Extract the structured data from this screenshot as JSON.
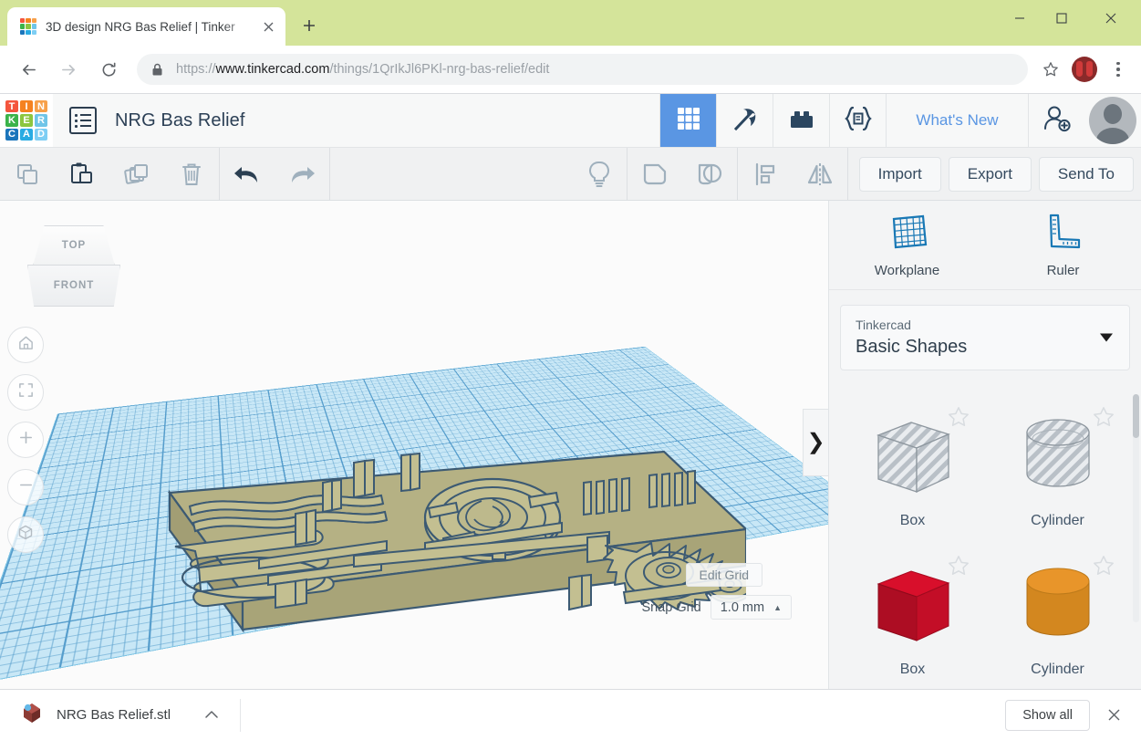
{
  "browser": {
    "tab": {
      "title": "3D design NRG Bas Relief | Tinker",
      "close_icon": "close-icon",
      "favicon_colors": [
        "#f4553d",
        "#f58220",
        "#f7a04a",
        "#3bb34a",
        "#8cc63f",
        "#6fc5e8",
        "#1b75bb",
        "#29abe2",
        "#7ecef4"
      ]
    },
    "new_tab_label": "+",
    "nav": {
      "back": "←",
      "forward": "→",
      "reload": "⟳"
    },
    "url": {
      "scheme": "https://",
      "host": "www.tinkercad.com",
      "path": "/things/1QrIkJl6PKl-nrg-bas-relief/edit"
    },
    "url_full": "https://www.tinkercad.com/things/1QrIkJl6PKl-nrg-bas-relief/edit",
    "window_controls": {
      "minimize": "minimize-icon",
      "maximize": "maximize-icon",
      "close": "close-icon"
    },
    "titlebar_color": "#d4e49a"
  },
  "tinkercad_header": {
    "logo_letters": [
      "T",
      "I",
      "N",
      "K",
      "E",
      "R",
      "C",
      "A",
      "D"
    ],
    "design_title": "NRG Bas Relief",
    "tools": [
      {
        "name": "3d-design",
        "icon": "grid-icon",
        "active": true
      },
      {
        "name": "minecraft",
        "icon": "pickaxe-icon",
        "active": false
      },
      {
        "name": "bricks",
        "icon": "lego-brick-icon",
        "active": false
      },
      {
        "name": "codeblocks",
        "icon": "codeblocks-icon",
        "active": false
      }
    ],
    "whats_new_label": "What's New",
    "invite_icon": "add-person-icon",
    "avatar_icon": "user-avatar",
    "accent_color": "#5a96e3"
  },
  "edit_toolbar": {
    "left_buttons": [
      {
        "name": "copy",
        "icon": "copy-icon",
        "enabled": false
      },
      {
        "name": "paste",
        "icon": "paste-icon",
        "enabled": true
      },
      {
        "name": "duplicate",
        "icon": "duplicate-icon",
        "enabled": false
      },
      {
        "name": "delete",
        "icon": "trash-icon",
        "enabled": false
      }
    ],
    "history_buttons": [
      {
        "name": "undo",
        "icon": "undo-arrow-icon",
        "enabled": true
      },
      {
        "name": "redo",
        "icon": "redo-arrow-icon",
        "enabled": false
      }
    ],
    "right_buttons": [
      {
        "name": "hint",
        "icon": "lightbulb-icon",
        "enabled": false
      },
      {
        "name": "group",
        "icon": "group-shapes-icon",
        "enabled": false
      },
      {
        "name": "ungroup",
        "icon": "ungroup-shapes-icon",
        "enabled": false
      },
      {
        "name": "align",
        "icon": "align-icon",
        "enabled": false
      },
      {
        "name": "mirror",
        "icon": "mirror-icon",
        "enabled": false
      }
    ],
    "import_label": "Import",
    "export_label": "Export",
    "send_to_label": "Send To"
  },
  "canvas": {
    "viewcube": {
      "top_label": "TOP",
      "front_label": "FRONT"
    },
    "nav_buttons": [
      {
        "name": "home-view",
        "icon": "home-icon"
      },
      {
        "name": "fit-to-view",
        "icon": "fit-frame-icon"
      },
      {
        "name": "zoom-in",
        "icon": "plus-icon"
      },
      {
        "name": "zoom-out",
        "icon": "minus-icon"
      },
      {
        "name": "perspective-toggle",
        "icon": "cube-view-icon"
      }
    ],
    "edit_grid_label": "Edit Grid",
    "snap_grid_label": "Snap Grid",
    "snap_grid_value": "1.0 mm",
    "snap_grid_caret": "▲",
    "panel_expander": "❯",
    "workplane_color": "#c8e7f6",
    "model_color": "#b5b184",
    "model_outline": "#3c5a73"
  },
  "right_panel": {
    "tools": [
      {
        "name": "workplane",
        "label": "Workplane",
        "icon": "workplane-icon"
      },
      {
        "name": "ruler",
        "label": "Ruler",
        "icon": "ruler-icon"
      }
    ],
    "library": {
      "owner": "Tinkercad",
      "collection": "Basic Shapes"
    },
    "shapes": [
      {
        "name": "box-hole",
        "label": "Box",
        "style": "hole",
        "color": "#b9c0c7"
      },
      {
        "name": "cylinder-hole",
        "label": "Cylinder",
        "style": "hole",
        "color": "#b9c0c7"
      },
      {
        "name": "box-solid",
        "label": "Box",
        "style": "solid",
        "color": "#c8102e"
      },
      {
        "name": "cylinder-solid",
        "label": "Cylinder",
        "style": "solid",
        "color": "#e08a26"
      }
    ]
  },
  "download_bar": {
    "file_name": "NRG Bas Relief.stl",
    "file_icon": "stl-file-icon",
    "expand_caret": "⌃",
    "show_all_label": "Show all",
    "close_icon": "×"
  }
}
